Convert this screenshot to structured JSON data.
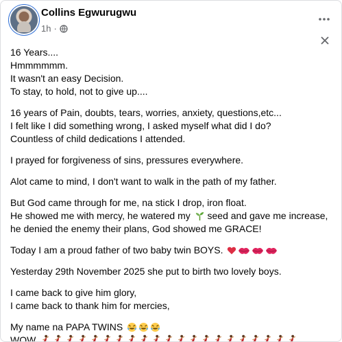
{
  "post": {
    "author": "Collins Egwurugwu",
    "time": "1h",
    "separator": "·",
    "paragraphs": [
      [
        "16 Years....",
        "Hmmmmmm.",
        "It wasn't an easy Decision.",
        "To stay, to hold, not to give up...."
      ],
      [
        "16 years of Pain, doubts, tears, worries, anxiety, questions,etc...",
        "I felt like I did something wrong, I asked myself what did I do?",
        "Countless of child dedications I attended."
      ],
      [
        "I prayed for forgiveness of sins, pressures everywhere."
      ],
      [
        "Alot came to mind, I don't want to walk in the path of my father."
      ],
      [
        "But God came through for me, na stick I drop, iron float."
      ],
      [
        "Yesterday 29th November 2025 she put to birth two lovely boys."
      ],
      [
        "I came back to give him glory,",
        "I came back to thank him for mercies,"
      ]
    ],
    "mercy_line": {
      "before": "He showed me with mercy, he watered my",
      "after": "seed and gave me increase, he denied the enemy their plans, God showed me GRACE!"
    },
    "proud_line": "Today I am a proud father of two baby twin BOYS.",
    "papa_line": "My name na PAPA TWINS",
    "wow_line": "WOW",
    "emojis": {
      "seedling": "seedling-emoji",
      "heart": "red-heart-emoji",
      "kiss": "kiss-mark-emoji",
      "laugh": "tears-of-joy-emoji",
      "dance": "dancing-woman-emoji"
    },
    "icons": {
      "more": "more-options-icon",
      "close": "close-icon",
      "audience": "globe-icon"
    }
  }
}
